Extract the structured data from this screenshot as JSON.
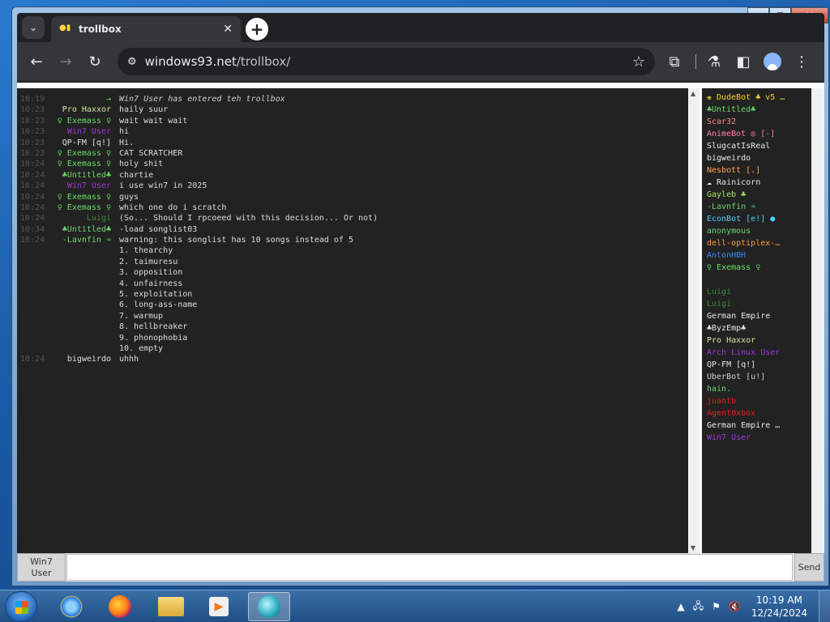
{
  "tab": {
    "title": "trollbox"
  },
  "toolbar": {
    "url_domain": "windows93.net",
    "url_path": "/trollbox/"
  },
  "messages": [
    {
      "time": "10:19",
      "nick": "→",
      "nick_color": "#6fe06f",
      "text": "Win7 User has entered teh trollbox",
      "text_color": "#cccccc"
    },
    {
      "time": "10:23",
      "nick": "Pro Haxxor",
      "nick_color": "#cfe6a0",
      "text": "haily suur"
    },
    {
      "time": "10:23",
      "nick": "♀ Exemass ♀",
      "nick_color": "#66e066",
      "text": "wait wait wait"
    },
    {
      "time": "10:23",
      "nick": "Win7 User",
      "nick_color": "#a335d9",
      "text": "hi"
    },
    {
      "time": "10:23",
      "nick": "QP-FM [q!]",
      "nick_color": "#e0e0e0",
      "text": "Hi."
    },
    {
      "time": "10:23",
      "nick": "♀ Exemass ♀",
      "nick_color": "#66e066",
      "text": "CAT SCRATCHER"
    },
    {
      "time": "10:24",
      "nick": "♀ Exemass ♀",
      "nick_color": "#66e066",
      "text": "holy shit"
    },
    {
      "time": "10:24",
      "nick": "♣Untitled♣",
      "nick_color": "#6fd66f",
      "text": "chartie"
    },
    {
      "time": "10:24",
      "nick": "Win7 User",
      "nick_color": "#a335d9",
      "text": "i use win7 in 2025"
    },
    {
      "time": "10:24",
      "nick": "♀ Exemass ♀",
      "nick_color": "#66e066",
      "text": "guys"
    },
    {
      "time": "10:24",
      "nick": "♀ Exemass ♀",
      "nick_color": "#66e066",
      "text": "which one do i scratch"
    },
    {
      "time": "10:24",
      "nick": "Luigi",
      "nick_color": "#3a8a3a",
      "text": "(So... Should I rpcoeed with this decision... Or not)"
    },
    {
      "time": "10:34",
      "nick": "♣Untitled♣",
      "nick_color": "#6fd66f",
      "text": "-load songlist03"
    },
    {
      "time": "10:24",
      "nick": "-Lavnfin ♒",
      "nick_color": "#6fd66f",
      "text": "warning: this songlist has 10 songs instead of 5"
    },
    {
      "time": "",
      "nick": "",
      "nick_color": "#ffffff",
      "text": "1. thearchy"
    },
    {
      "time": "",
      "nick": "",
      "nick_color": "#ffffff",
      "text": "2. taimuresu"
    },
    {
      "time": "",
      "nick": "",
      "nick_color": "#ffffff",
      "text": "3. opposition"
    },
    {
      "time": "",
      "nick": "",
      "nick_color": "#ffffff",
      "text": "4. unfairness"
    },
    {
      "time": "",
      "nick": "",
      "nick_color": "#ffffff",
      "text": "5. exploitation"
    },
    {
      "time": "",
      "nick": "",
      "nick_color": "#ffffff",
      "text": "6. long-ass-name"
    },
    {
      "time": "",
      "nick": "",
      "nick_color": "#ffffff",
      "text": "7. warmup"
    },
    {
      "time": "",
      "nick": "",
      "nick_color": "#ffffff",
      "text": "8. hellbreaker"
    },
    {
      "time": "",
      "nick": "",
      "nick_color": "#ffffff",
      "text": "9. phonophobia"
    },
    {
      "time": "",
      "nick": "",
      "nick_color": "#ffffff",
      "text": "10. empty"
    },
    {
      "time": "10:24",
      "nick": "bigweirdo",
      "nick_color": "#e0e0e0",
      "text": "uhhh"
    }
  ],
  "users": [
    {
      "name": "♚ DudeBot ♣ v5 …",
      "color": "#ffcc33"
    },
    {
      "name": "♣Untitled♣",
      "color": "#6fd66f"
    },
    {
      "name": "Scar32",
      "color": "#ff8c8c"
    },
    {
      "name": "AnimeBot ◎ [-]",
      "color": "#ff7fa8"
    },
    {
      "name": "SlugcatIsReal",
      "color": "#e8e8e8"
    },
    {
      "name": "bigweirdo",
      "color": "#e8e8e8"
    },
    {
      "name": "Nesbott [.]",
      "color": "#ffa54a"
    },
    {
      "name": "☁ Rainicorn",
      "color": "#e8e8e8"
    },
    {
      "name": "Gayleb ♣",
      "color": "#a8e060"
    },
    {
      "name": "-Lavnfin ♒",
      "color": "#6fd66f"
    },
    {
      "name": "EconBot [e!] ●",
      "color": "#4fd0ff"
    },
    {
      "name": "anonymous",
      "color": "#6fd66f"
    },
    {
      "name": "dell-optiplex-…",
      "color": "#ff9a3c"
    },
    {
      "name": "AntonHBH",
      "color": "#3a8af0"
    },
    {
      "name": "♀ Exemass ♀",
      "color": "#66e066"
    },
    {
      "name": "",
      "color": "#6a2fb0"
    },
    {
      "name": "Luigi",
      "color": "#3a8a3a"
    },
    {
      "name": "Luigi",
      "color": "#3a8a3a"
    },
    {
      "name": "German Empire",
      "color": "#e8e8e8"
    },
    {
      "name": "♣ByzEmp♣",
      "color": "#e8e8e8"
    },
    {
      "name": "Pro Haxxor",
      "color": "#cfe6a0"
    },
    {
      "name": "Arch Linux User",
      "color": "#a335d9"
    },
    {
      "name": "QP-FM [q!]",
      "color": "#e8e8e8"
    },
    {
      "name": "UberBot [u!]",
      "color": "#cccccc"
    },
    {
      "name": "hain.",
      "color": "#6fd66f"
    },
    {
      "name": "juantb",
      "color": "#e02020"
    },
    {
      "name": "Agent0xbox",
      "color": "#e02020"
    },
    {
      "name": "German Empire …",
      "color": "#e8e8e8"
    },
    {
      "name": "Win7 User",
      "color": "#a335d9"
    }
  ],
  "input": {
    "nick_line1": "Win7",
    "nick_line2": "User",
    "value": "",
    "send_label": "Send"
  },
  "taskbar": {
    "time": "10:19 AM",
    "date": "12/24/2024",
    "apps": [
      "internet-explorer-icon",
      "firefox-icon",
      "file-explorer-icon",
      "media-player-icon",
      "browser-active-icon"
    ]
  }
}
